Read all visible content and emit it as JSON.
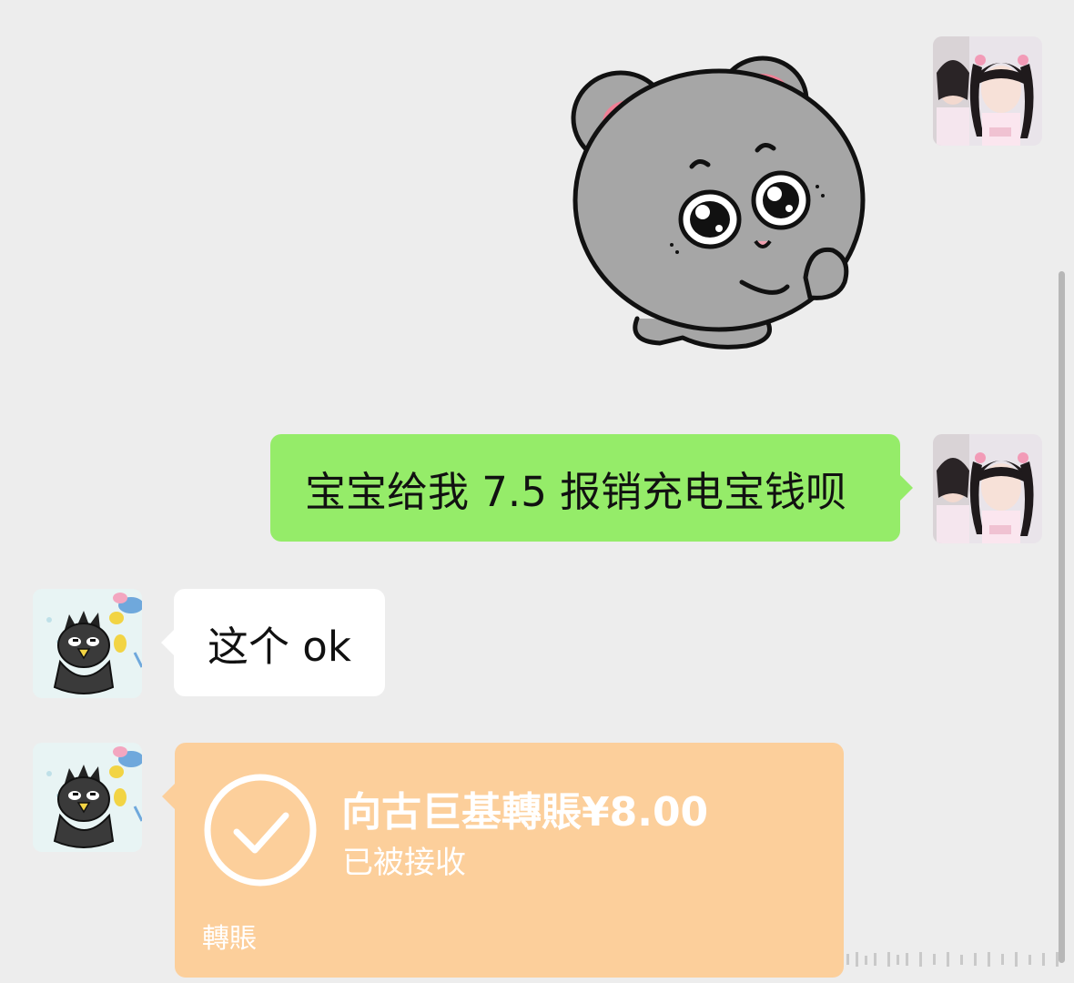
{
  "messages": {
    "green_text": "宝宝给我 7.5 报销充电宝钱呗",
    "white_text": "这个 ok"
  },
  "transfer": {
    "title": "向古巨基轉賬¥8.00",
    "status": "已被接收",
    "footer": "轉賬"
  },
  "icons": {
    "sticker": "gray-mouse-sticker",
    "check": "check-circle-icon",
    "self_avatar": "girl-photo-avatar",
    "other_avatar": "badtz-maru-avatar"
  },
  "colors": {
    "background": "#ededed",
    "sent_bubble": "#95ec69",
    "received_bubble": "#ffffff",
    "transfer_card": "#fccf9b"
  }
}
